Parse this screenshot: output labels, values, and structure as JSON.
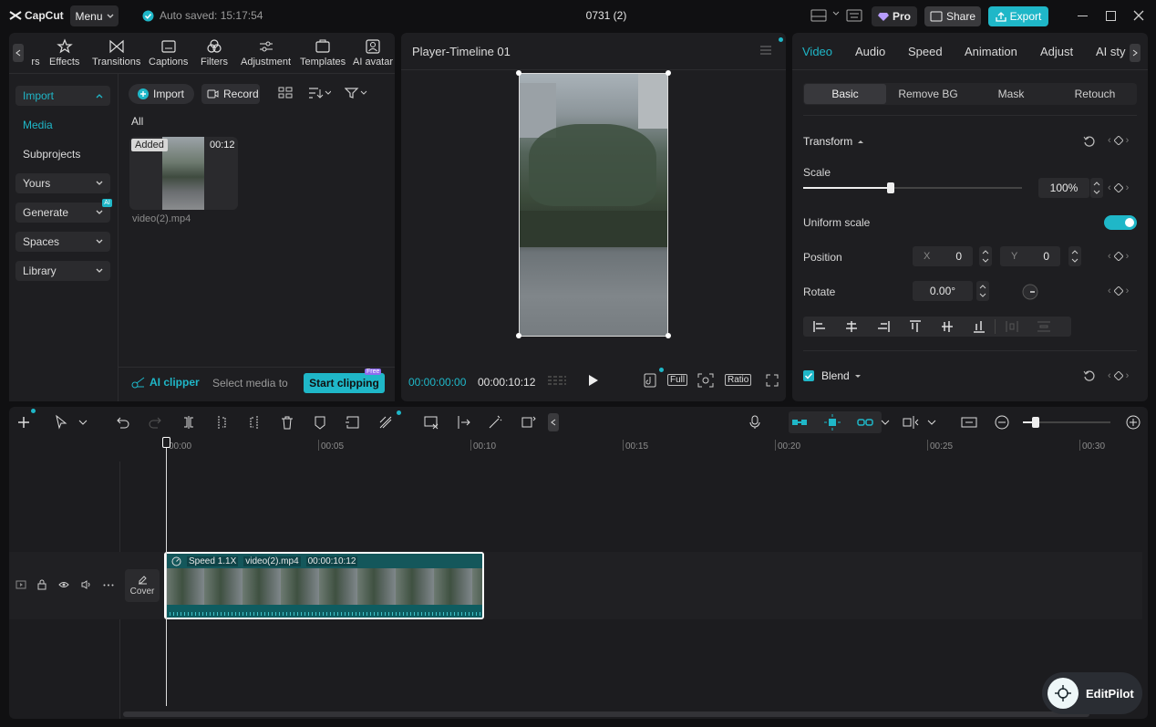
{
  "titlebar": {
    "logo": "CapCut",
    "menu_label": "Menu",
    "autosave": "Auto saved: 15:17:54",
    "project_title": "0731 (2)",
    "pro_label": "Pro",
    "share_label": "Share",
    "export_label": "Export"
  },
  "toolbar": {
    "tabs": [
      {
        "label": "rs",
        "icon": "stickers-icon"
      },
      {
        "label": "Effects",
        "icon": "effects-icon"
      },
      {
        "label": "Transitions",
        "icon": "transitions-icon"
      },
      {
        "label": "Captions",
        "icon": "captions-icon"
      },
      {
        "label": "Filters",
        "icon": "filters-icon"
      },
      {
        "label": "Adjustment",
        "icon": "adjustment-icon"
      },
      {
        "label": "Templates",
        "icon": "templates-icon"
      },
      {
        "label": "AI avatar",
        "icon": "ai-avatar-icon"
      }
    ]
  },
  "sidebar": {
    "items": [
      {
        "label": "Import"
      },
      {
        "label": "Media"
      },
      {
        "label": "Subprojects"
      },
      {
        "label": "Yours"
      },
      {
        "label": "Generate"
      },
      {
        "label": "Spaces"
      },
      {
        "label": "Library"
      }
    ],
    "ai_badge": "AI"
  },
  "media": {
    "import_label": "Import",
    "record_label": "Record",
    "filter_all": "All",
    "clip": {
      "badge": "Added",
      "duration": "00:12",
      "name": "video(2).mp4"
    },
    "ai_clipper_label": "AI clipper",
    "ai_clipper_hint": "Select media to",
    "start_clipping_label": "Start clipping",
    "free_badge": "Free"
  },
  "player": {
    "title": "Player-Timeline 01",
    "current_time": "00:00:00:00",
    "total_time": "00:00:10:12",
    "full_label": "Full",
    "ratio_label": "Ratio"
  },
  "props": {
    "tabs": [
      "Video",
      "Audio",
      "Speed",
      "Animation",
      "Adjust",
      "AI sty"
    ],
    "subtabs": [
      "Basic",
      "Remove BG",
      "Mask",
      "Retouch"
    ],
    "transform_label": "Transform",
    "scale_label": "Scale",
    "scale_value": "100%",
    "scale_level": 0.4,
    "uniform_scale_label": "Uniform scale",
    "position_label": "Position",
    "x_label": "X",
    "x_value": "0",
    "y_label": "Y",
    "y_value": "0",
    "rotate_label": "Rotate",
    "rotate_value": "0.00°",
    "blend_label": "Blend"
  },
  "timeline": {
    "ruler_labels": [
      "00:00",
      "00:05",
      "00:10",
      "00:15",
      "00:20",
      "00:25",
      "00:30"
    ],
    "clip": {
      "speed": "Speed 1.1X",
      "name": "video(2).mp4",
      "duration": "00:00:10:12"
    },
    "cover_label": "Cover"
  },
  "assistant": {
    "label": "EditPilot"
  },
  "colors": {
    "accent": "#1fb7c8",
    "panel": "#1e1e21",
    "bg": "#101012"
  }
}
